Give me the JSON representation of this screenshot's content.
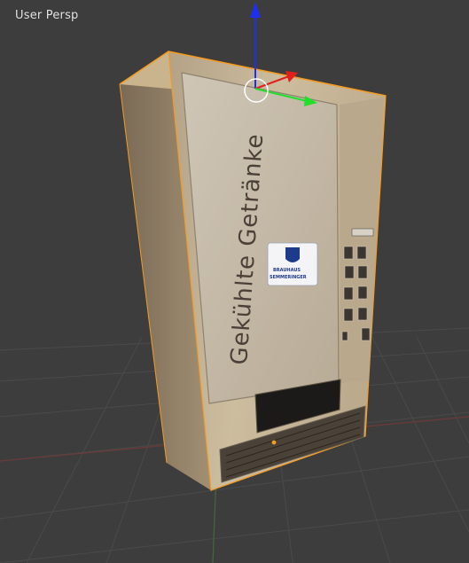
{
  "viewport": {
    "label": "User Persp",
    "background_color": "#3d3d3d",
    "grid_color": "#4a4a4a"
  },
  "object": {
    "name_text": "Gekühlte Getränke",
    "logo_text_line1": "BRAUHAUS",
    "logo_text_line2": "SEMMERINGER",
    "selection_outline_color": "#f59b20",
    "body_color": "#cbb79a"
  },
  "gizmo": {
    "z_axis_color": "#1f2ff0",
    "x_axis_color": "#e0201c",
    "y_axis_color": "#1fe02a",
    "cursor_icon": "3d-cursor-icon"
  }
}
